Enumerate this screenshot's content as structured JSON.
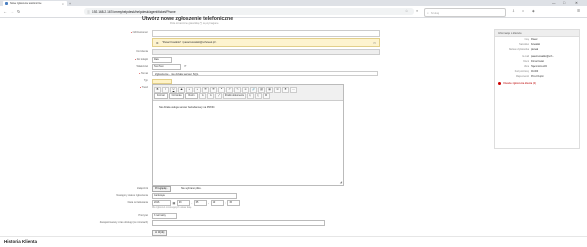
{
  "browser": {
    "tab_title": "Nowe zgłoszenie telefoniczne",
    "tab_close": "×",
    "new_tab": "+",
    "url": "192.168.2.167/ommyhelpdesk/helpdesk/agent/ticket/Phone",
    "search_placeholder": "Szukaj",
    "win_min": "—",
    "win_max": "□",
    "win_close": "✕"
  },
  "page": {
    "title": "Utwórz nowe zgłoszenie telefoniczne",
    "subtitle": "Pola oznaczone gwiazdką (*) są wymagane."
  },
  "form": {
    "from_label": "Od/Customer",
    "from_value": "",
    "chip_text": "\"Pawel Kowalski\" <pawel.kowalski@schowek.pl>",
    "cc_label": "Do klienta",
    "cc_value": "",
    "inbox_label": "Do kolejki",
    "queue_value": "Raw",
    "owner_label": "Właściciel",
    "owner_value": "Test Test",
    "subject_label": "Temat",
    "subject_value": "Zgłoszenie - nie działa serwer SQL",
    "type_label": "Typ",
    "type_value": "",
    "text_label": "Treść",
    "attachment_label": "Załącznik",
    "attachment_button": "Przeglądaj...",
    "attachment_status": "Nie wybrano pliku.",
    "next_state_label": "Następny status zgłoszenia",
    "next_state_value": "zamknięte",
    "pending_label": "Data oczekiwania",
    "pending_year": "2016",
    "pending_month": "03",
    "pending_day": "05",
    "pending_hour": "10",
    "pending_minute": "15",
    "pending_hint": "Dla zgłoszeń oczekujących ustaw datę.",
    "priority_label": "Priorytet",
    "priority_value": "3 normalny",
    "time_label": "Zarejestrowany czas obsługi (w minutach)",
    "time_value": "",
    "submit": "Wyślij"
  },
  "editor": {
    "row1": [
      "B",
      "I",
      "U",
      "S",
      "≡",
      "≡",
      "☰",
      "☰",
      "❝",
      "↶",
      "↷",
      "⊘",
      "🔗",
      "⛓",
      "▦",
      "Ω",
      "⚑",
      "⋯"
    ],
    "format_select": "Format",
    "font_select": "Czcionka",
    "size_select": "Rozm.",
    "row2_extra": [
      "A",
      "A",
      "⤢"
    ],
    "source_button": "Źródło dokumentu",
    "row2_tail": [
      "⎘",
      "⎗",
      "⌘"
    ],
    "body_text": "Nie działa usługa serwer bazodanowy na PROD.",
    "resize": "◢"
  },
  "sidebar": {
    "title": "Informacje o kliencie",
    "rows": [
      {
        "key": "Imię",
        "value": "Paweł"
      },
      {
        "key": "Nazwisko",
        "value": "Kowalski"
      },
      {
        "key": "Nazwa użytkownika",
        "value": "pkowal"
      },
      {
        "key": "E-mail",
        "value": "pawel.kowalski@sch..."
      },
      {
        "key": "Klient",
        "value": "Firma Kowal"
      },
      {
        "key": "Ulica",
        "value": "Tajemnicza 222"
      },
      {
        "key": "Kod pocztowy",
        "value": "00-000"
      },
      {
        "key": "Miejscowość",
        "value": "Przez Dupki"
      }
    ],
    "link": "Otwarte zgłoszenia klienta (0)"
  },
  "history": {
    "title": "Historia Klienta"
  }
}
